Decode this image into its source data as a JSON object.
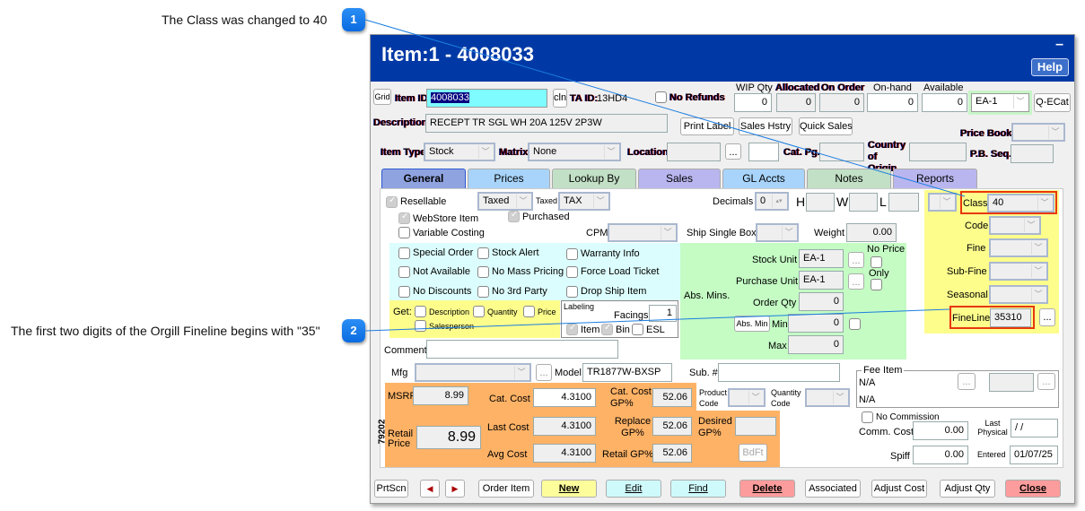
{
  "callouts": [
    {
      "number": "1",
      "text": "The Class was changed to 40"
    },
    {
      "number": "2",
      "text": "The first two digits of the Orgill Fineline begins with \"35\""
    }
  ],
  "window": {
    "title": "Item:1 - 4008033",
    "minimize": "–",
    "help": "Help"
  },
  "header": {
    "grid_button": "Grid",
    "item_id_label": "Item ID",
    "item_id_value": "4008033",
    "cln_button": "cln",
    "ta_id_label": "TA ID:",
    "ta_id_value": "13HD4",
    "no_refunds_label": "No Refunds",
    "description_label": "Description",
    "description_value": "RECEPT TR SGL WH 20A 125V 2P3W",
    "print_label_button": "Print Label",
    "sales_history_button": "Sales Hstry",
    "quick_sales_button": "Quick Sales",
    "item_type_label": "Item Type",
    "item_type_value": "Stock",
    "matrix_label": "Matrix",
    "matrix_value": "None",
    "location_label": "Location",
    "location_value": "",
    "cat_pg_label": "Cat. Pg.",
    "country_label": "Country of Origin",
    "price_book_label": "Price Book",
    "pb_seq_label": "P.B. Seq.",
    "qty": {
      "wip_label": "WIP Qty",
      "wip": "0",
      "allocated_label": "Allocated",
      "allocated": "0",
      "on_order_label": "On Order",
      "on_order": "0",
      "on_hand_label": "On-hand",
      "on_hand": "0",
      "available_label": "Available",
      "available": "0"
    },
    "unit_value": "EA-1",
    "q_ecat_button": "Q-ECat"
  },
  "tabs": [
    {
      "label": "General",
      "color": "#8fa3e0",
      "active": true
    },
    {
      "label": "Prices",
      "color": "#a8d4fb"
    },
    {
      "label": "Lookup By",
      "color": "#c2e0c6"
    },
    {
      "label": "Sales",
      "color": "#b9b6ef"
    },
    {
      "label": "GL Accts",
      "color": "#a8d4fb"
    },
    {
      "label": "Notes",
      "color": "#c2e0c6"
    },
    {
      "label": "Reports",
      "color": "#b9b6ef"
    }
  ],
  "general": {
    "resellable": "Resellable",
    "taxed_combo": "Taxed",
    "taxed_label": "Taxed",
    "tax_combo": "TAX",
    "webstore_item": "WebStore Item",
    "purchased": "Purchased",
    "variable_costing": "Variable Costing",
    "cpm_label": "CPM",
    "decimals_label": "Decimals",
    "decimals_value": "0",
    "h_label": "H",
    "w_label": "W",
    "l_label": "L",
    "ship_single_box": "Ship Single Box",
    "weight_label": "Weight",
    "weight_value": "0.00",
    "flags": [
      "Special Order",
      "Stock Alert",
      "Warranty Info",
      "Not Available",
      "No Mass Pricing",
      "Force Load Ticket",
      "No Discounts",
      "No 3rd Party",
      "Drop Ship Item"
    ],
    "get_label": "Get:",
    "get_options": [
      "Description",
      "Quantity",
      "Price",
      "Salesperson"
    ],
    "labeling_label": "Labeling",
    "facings_label": "Facings",
    "facings_value": "1",
    "label_item": "Item",
    "label_bin": "Bin",
    "label_esl": "ESL",
    "comment_label": "Comment",
    "stock_unit_label": "Stock Unit",
    "stock_unit_value": "EA-1",
    "purchase_unit_label": "Purchase Unit",
    "purchase_unit_value": "EA-1",
    "no_price_label": "No Price",
    "only_label": "Only",
    "abs_mins_label": "Abs. Mins.",
    "order_qty_label": "Order Qty",
    "order_qty_value": "0",
    "abs_min_button": "Abs. Min",
    "min_label": "Min",
    "min_value": "0",
    "max_label": "Max",
    "max_value": "0",
    "class_label": "Class",
    "class_value": "40",
    "code_label": "Code",
    "fine_label": "Fine",
    "sub_fine_label": "Sub-Fine",
    "seasonal_label": "Seasonal",
    "fineline_label": "FineLine",
    "fineline_value": "35310",
    "mfg_label": "Mfg",
    "model_label": "Model",
    "model_value": "TR1877W-BXSP",
    "sub_label": "Sub. #",
    "side_code": "79202",
    "msrp_label": "MSRP",
    "msrp_value": "8.99",
    "cat_cost_label": "Cat. Cost",
    "cat_cost_value": "4.3100",
    "cat_cost_gp_label": "Cat. Cost GP%",
    "cat_cost_gp_value": "52.06",
    "product_code_label": "Product Code",
    "quantity_code_label": "Quantity Code",
    "retail_price_label": "Retail Price",
    "retail_price_value": "8.99",
    "last_cost_label": "Last Cost",
    "last_cost_value": "4.3100",
    "replace_gp_label": "Replace GP%",
    "replace_gp_value": "52.06",
    "desired_gp_label": "Desired GP%",
    "avg_cost_label": "Avg Cost",
    "avg_cost_value": "4.3100",
    "retail_gp_label": "Retail GP%",
    "retail_gp_value": "52.06",
    "bdft_button": "BdFt",
    "fee_item_label": "Fee Item",
    "fee_na_1": "N/A",
    "fee_na_2": "N/A",
    "no_commission": "No Commission",
    "comm_cost_label": "Comm. Cost",
    "comm_cost_value": "0.00",
    "last_physical_label": "Last Physical",
    "last_physical_value": " /  /",
    "spiff_label": "Spiff",
    "spiff_value": "0.00",
    "entered_label": "Entered",
    "entered_value": "01/07/25",
    "ellipsis": "..."
  },
  "footer": {
    "prtscn": "PrtScn",
    "prev": "◀",
    "next": "▶",
    "order_item": "Order Item",
    "new": "New",
    "edit": "Edit",
    "find": "Find",
    "delete": "Delete",
    "associated": "Associated",
    "adjust_cost": "Adjust Cost",
    "adjust_qty": "Adjust Qty",
    "close": "Close"
  }
}
